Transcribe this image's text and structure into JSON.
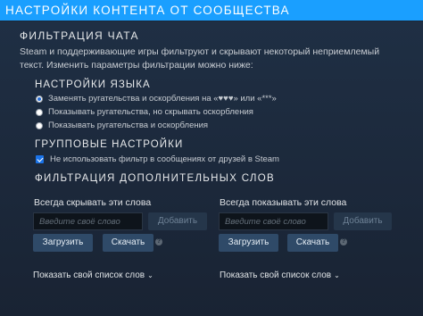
{
  "header": {
    "title": "НАСТРОЙКИ КОНТЕНТА ОТ СООБЩЕСТВА"
  },
  "chat_filter": {
    "title": "ФИЛЬТРАЦИЯ ЧАТА",
    "description": "Steam и поддерживающие игры фильтруют и скрывают некоторый неприемлемый текст. Изменить параметры фильтрации можно ниже:"
  },
  "language": {
    "title": "НАСТРОЙКИ ЯЗЫКА",
    "options": [
      {
        "label": "Заменять ругательства и оскорбления на «♥♥♥» или «***»",
        "selected": true
      },
      {
        "label": "Показывать ругательства, но скрывать оскорбления",
        "selected": false
      },
      {
        "label": "Показывать ругательства и оскорбления",
        "selected": false
      }
    ]
  },
  "group": {
    "title": "ГРУППОВЫЕ НАСТРОЙКИ",
    "checkbox_label": "Не использовать фильтр в сообщениях от друзей в Steam",
    "checked": true
  },
  "extra": {
    "title": "ФИЛЬТРАЦИЯ ДОПОЛНИТЕЛЬНЫХ СЛОВ",
    "left": {
      "label": "Всегда скрывать эти слова",
      "placeholder": "Введите своё слово",
      "add": "Добавить",
      "upload": "Загрузить",
      "download": "Скачать",
      "help": "?",
      "show_list": "Показать свой список слов"
    },
    "right": {
      "label": "Всегда показывать эти слова",
      "placeholder": "Введите своё слово",
      "add": "Добавить",
      "upload": "Загрузить",
      "download": "Скачать",
      "help": "?",
      "show_list": "Показать свой список слов"
    }
  },
  "colors": {
    "header_bg": "#1a9fff",
    "page_bg": "#1b2838",
    "button_bg": "#2f4a68"
  },
  "icons": {
    "chevron": "chevron-double-down-icon",
    "help": "help-icon"
  }
}
